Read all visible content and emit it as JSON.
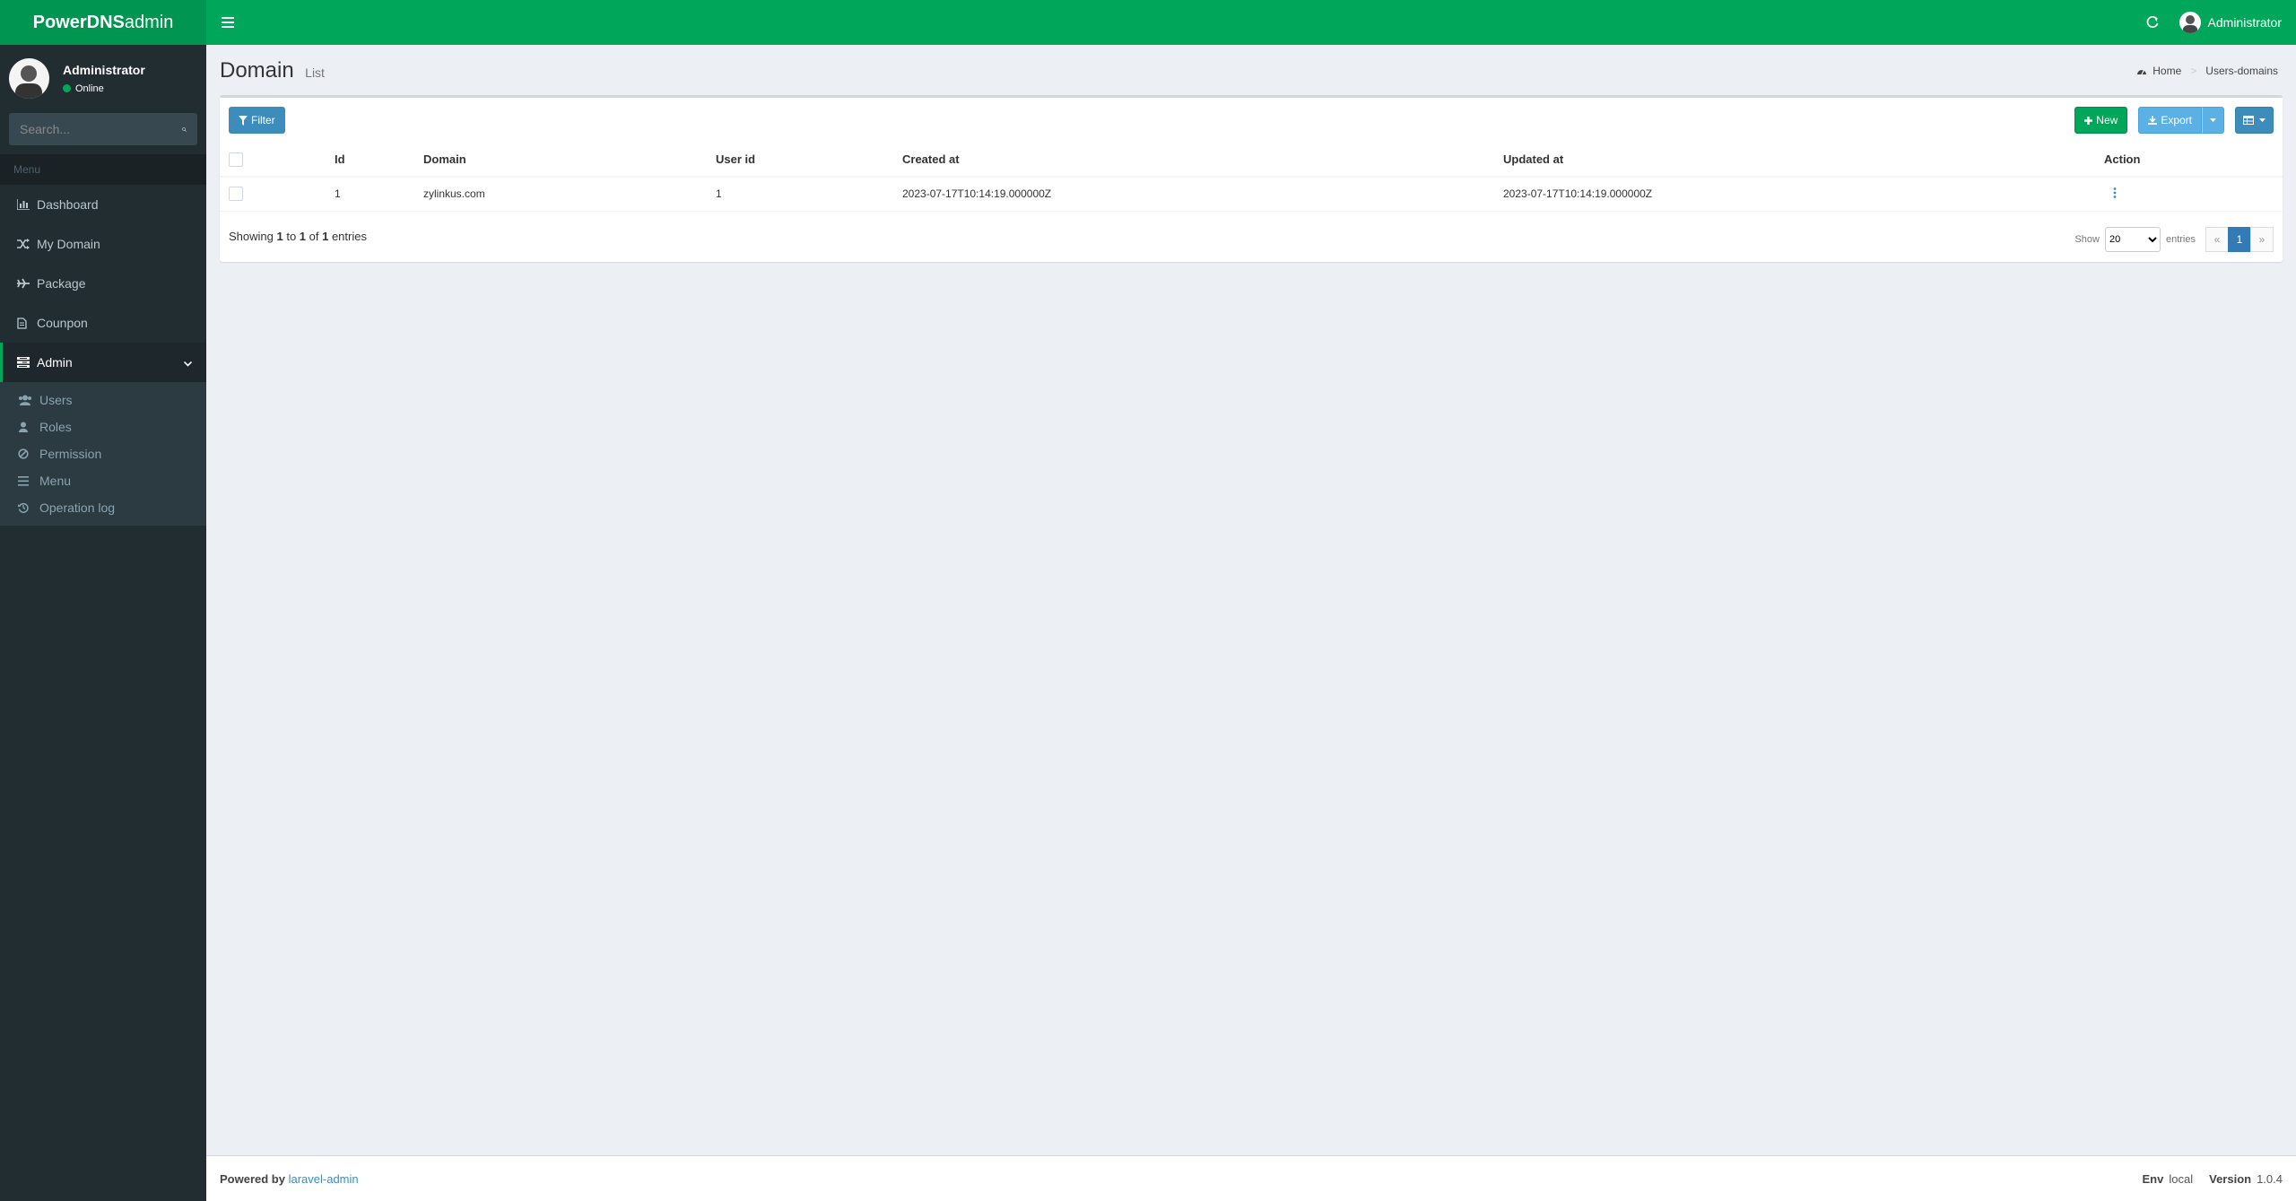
{
  "header": {
    "logo_bold": "PowerDNS",
    "logo_rest": " admin",
    "user_name": "Administrator"
  },
  "sidebar": {
    "user_name": "Administrator",
    "user_status": "Online",
    "search_placeholder": "Search...",
    "menu_header": "Menu",
    "items": [
      {
        "label": "Dashboard",
        "icon": "bar-chart-icon"
      },
      {
        "label": "My Domain",
        "icon": "random-icon"
      },
      {
        "label": "Package",
        "icon": "plane-icon"
      },
      {
        "label": "Counpon",
        "icon": "file-icon"
      },
      {
        "label": "Admin",
        "icon": "tasks-icon"
      }
    ],
    "subitems": [
      {
        "label": "Users",
        "icon": "users-icon"
      },
      {
        "label": "Roles",
        "icon": "user-icon"
      },
      {
        "label": "Permission",
        "icon": "ban-icon"
      },
      {
        "label": "Menu",
        "icon": "bars-icon"
      },
      {
        "label": "Operation log",
        "icon": "history-icon"
      }
    ]
  },
  "page": {
    "title": "Domain",
    "subtitle": "List",
    "breadcrumb_home": "Home",
    "breadcrumb_current": "Users-domains"
  },
  "toolbar": {
    "filter_label": "Filter",
    "new_label": "New",
    "export_label": "Export"
  },
  "table": {
    "columns": [
      "Id",
      "Domain",
      "User id",
      "Created at",
      "Updated at",
      "Action"
    ],
    "rows": [
      {
        "id": "1",
        "domain": "zylinkus.com",
        "user_id": "1",
        "created_at": "2023-07-17T10:14:19.000000Z",
        "updated_at": "2023-07-17T10:14:19.000000Z"
      }
    ]
  },
  "pagination": {
    "showing_prefix": "Showing ",
    "from": "1",
    "to_text": " to ",
    "to": "1",
    "of_text": " of ",
    "total": "1",
    "suffix": " entries",
    "show_label": "Show",
    "per_page": "20",
    "entries_label": "entries",
    "prev": "«",
    "current_page": "1",
    "next": "»"
  },
  "footer": {
    "powered_by": "Powered by",
    "link": "laravel-admin",
    "env_label": "Env",
    "env_value": "local",
    "version_label": "Version",
    "version_value": "1.0.4"
  },
  "colors": {
    "brand": "#00a65a",
    "sidebar": "#222d32",
    "primary": "#3c8dbc"
  }
}
